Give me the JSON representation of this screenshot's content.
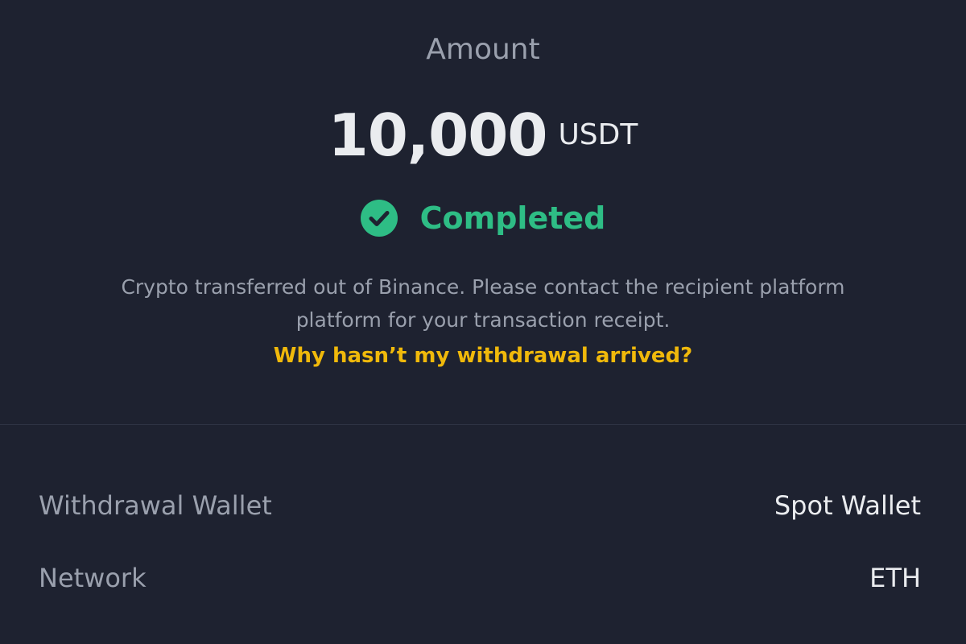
{
  "amount": {
    "label": "Amount",
    "value": "10,000",
    "unit": "USDT"
  },
  "status": {
    "icon": "check-circle-icon",
    "text": "Completed",
    "color": "#2ebd85"
  },
  "notice": {
    "line1": "Crypto transferred out of Binance. Please contact the recipient platform",
    "line2": "platform for your transaction receipt."
  },
  "help_link": {
    "text": "Why hasn’t my withdrawal arrived?",
    "color": "#f0b90b"
  },
  "details": [
    {
      "label": "Withdrawal Wallet",
      "value": "Spot Wallet"
    },
    {
      "label": "Network",
      "value": "ETH"
    }
  ],
  "colors": {
    "background": "#1e2230",
    "muted_text": "#9aa0ad",
    "primary_text": "#eaecef"
  }
}
